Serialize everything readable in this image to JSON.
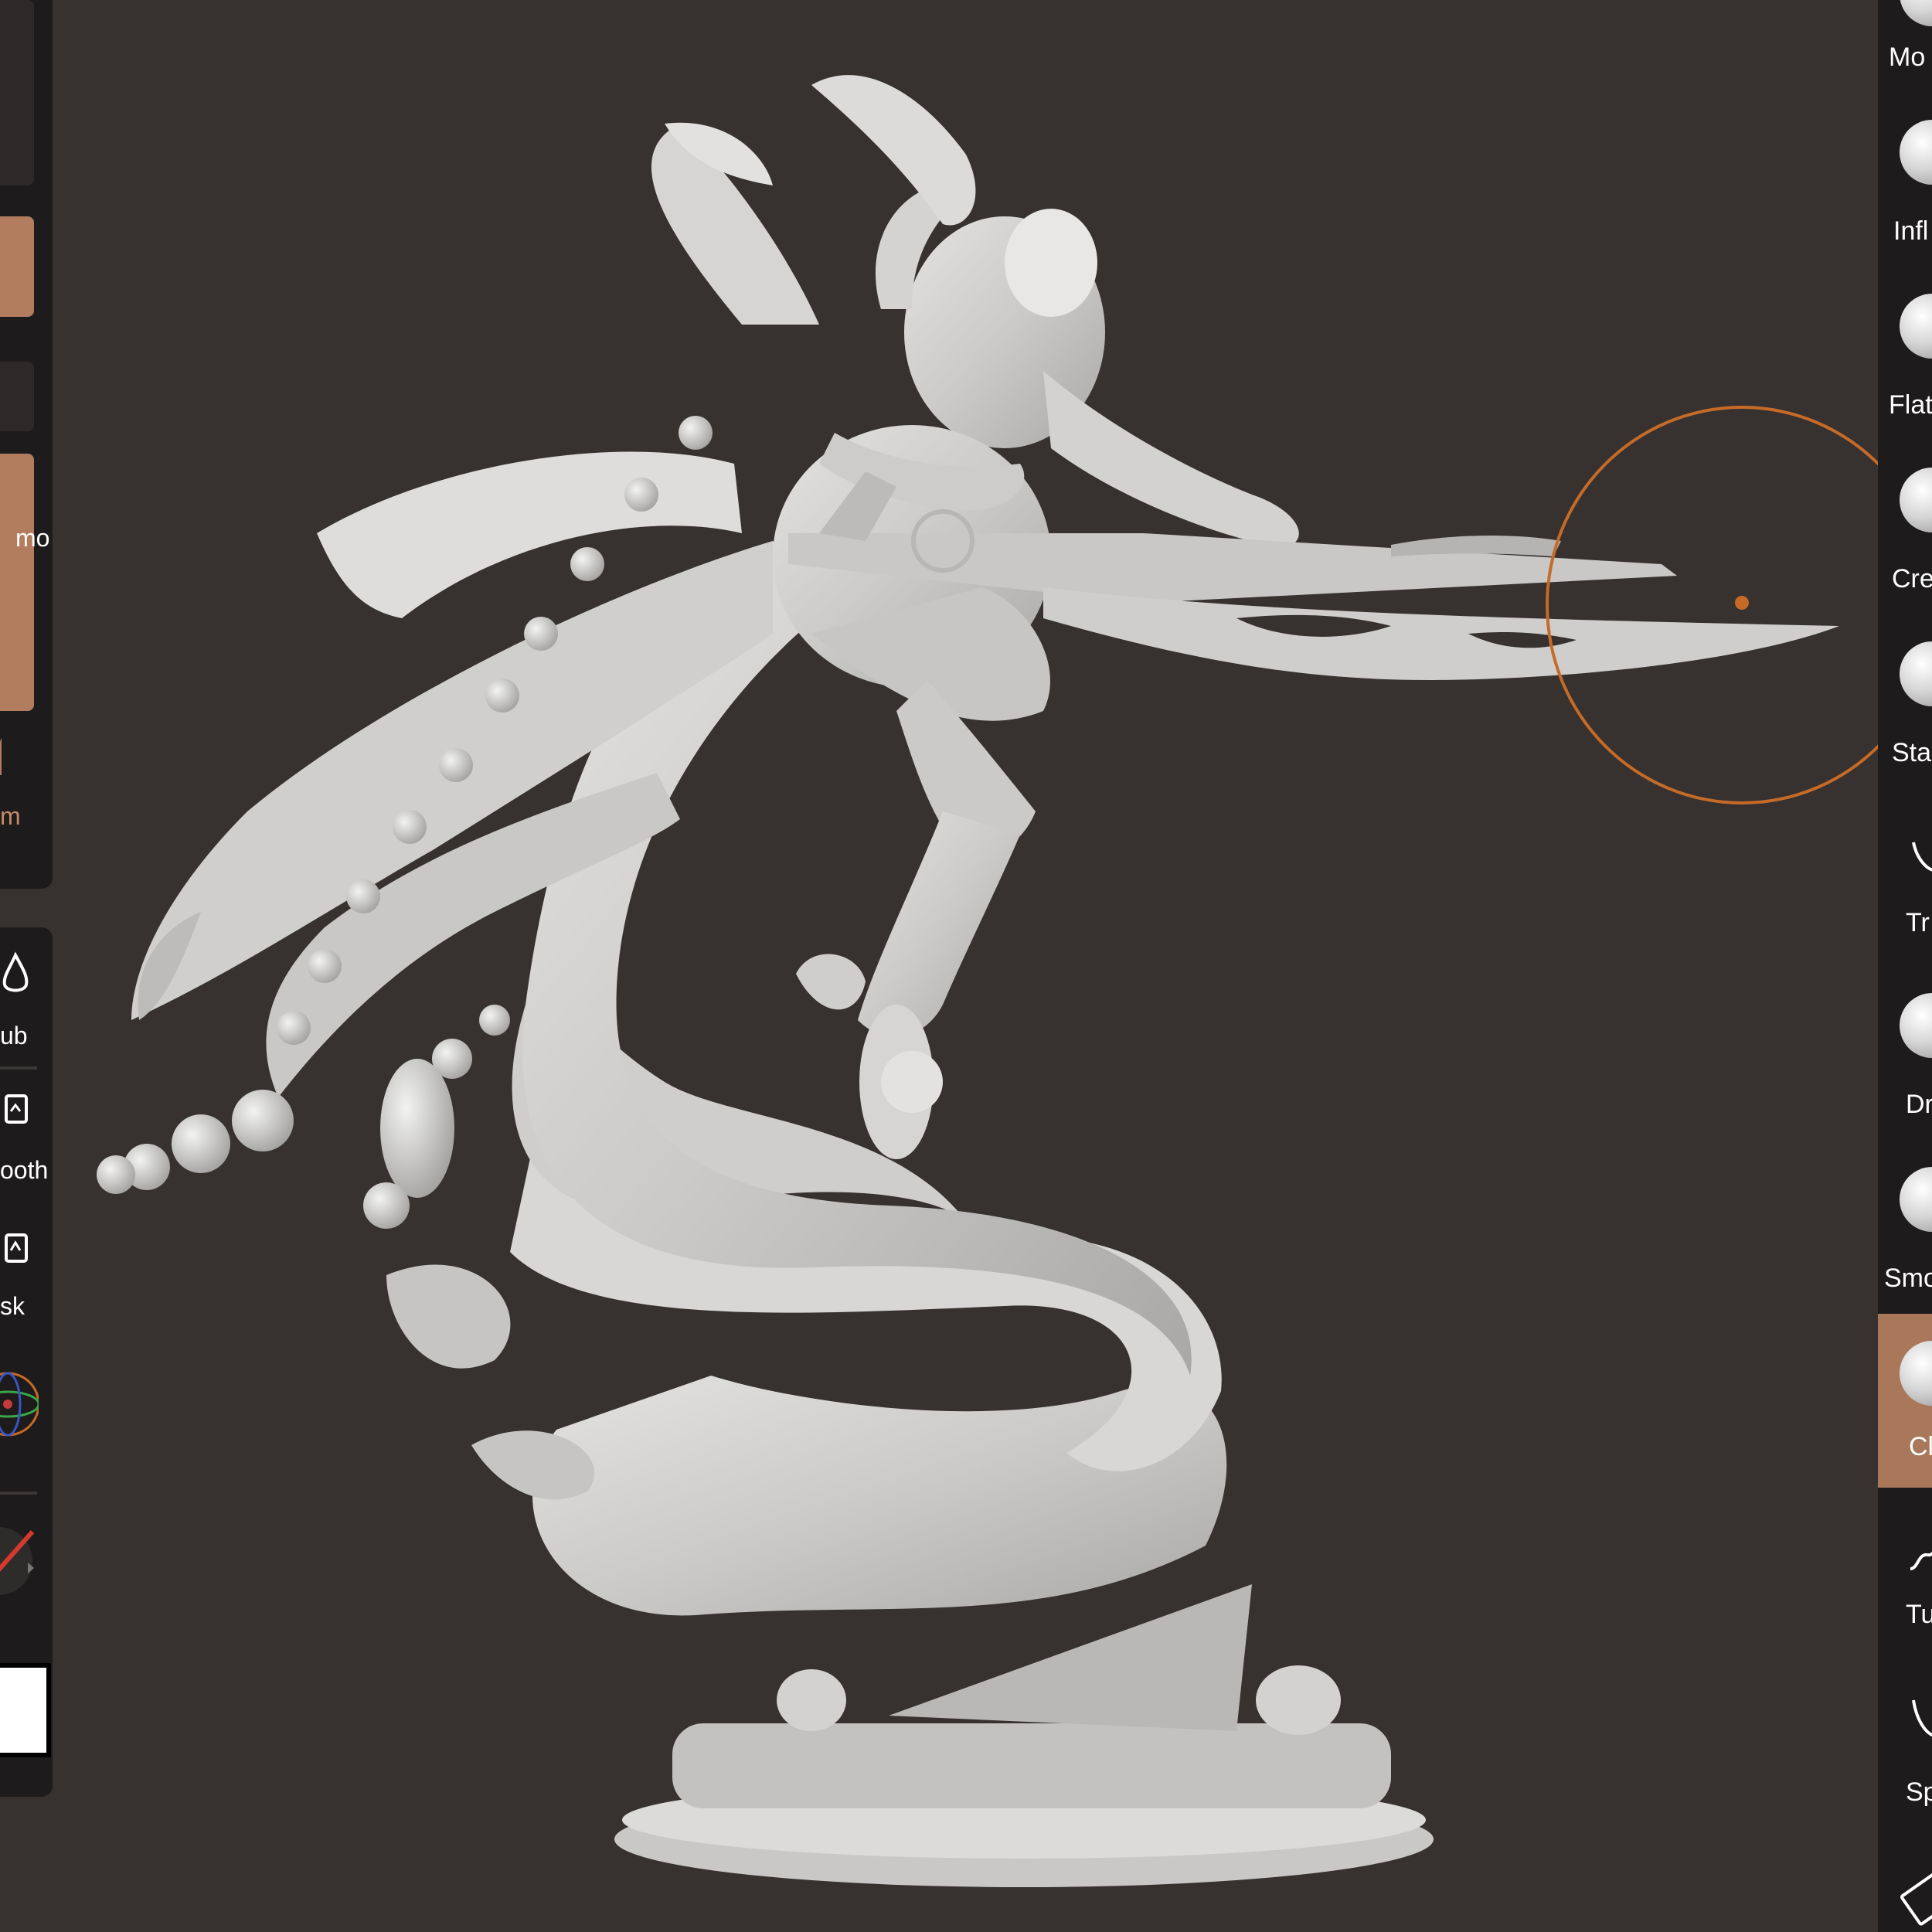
{
  "app": {
    "name": "sculpting-app",
    "accent_color": "#c56b27",
    "active_color": "#a9785b"
  },
  "left_toolbar": {
    "size_label": "m",
    "tools": [
      {
        "icon": "brush-icon",
        "label": "ub"
      },
      {
        "icon": "smooth-icon",
        "label": "ooth"
      },
      {
        "icon": "mask-icon",
        "label": "sk"
      },
      {
        "icon": "gizmo-icon",
        "label": "mo"
      }
    ],
    "color_swatch": "#ffffff"
  },
  "right_toolbar": {
    "tools": [
      {
        "label": "Mo",
        "icon": "move-brush-icon"
      },
      {
        "label": "Infl",
        "icon": "inflate-brush-icon"
      },
      {
        "label": "Flat",
        "icon": "flatten-brush-icon"
      },
      {
        "label": "Cre",
        "icon": "crease-brush-icon"
      },
      {
        "label": "Sta",
        "icon": "stamp-brush-icon"
      },
      {
        "label": "Tr",
        "icon": "trim-brush-icon"
      },
      {
        "label": "Dr",
        "icon": "drag-brush-icon"
      },
      {
        "label": "Smo",
        "icon": "smudge-brush-icon"
      },
      {
        "label": "Cl",
        "icon": "clay-brush-icon",
        "active": true
      },
      {
        "label": "Tu",
        "icon": "tube-brush-icon"
      },
      {
        "label": "Sp",
        "icon": "spiral-brush-icon"
      }
    ]
  }
}
